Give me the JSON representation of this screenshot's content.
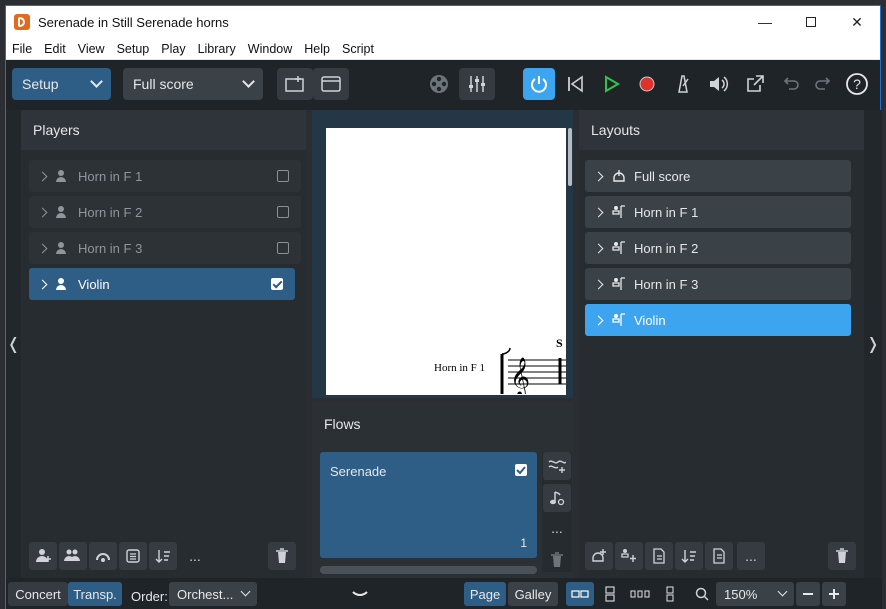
{
  "window": {
    "title": "Serenade in Still Serenade horns"
  },
  "menu": [
    "File",
    "Edit",
    "View",
    "Setup",
    "Play",
    "Library",
    "Window",
    "Help",
    "Script"
  ],
  "toolbar": {
    "mode": "Setup",
    "layout_select": "Full score"
  },
  "players_panel": {
    "heading": "Players",
    "items": [
      {
        "label": "Horn in F 1",
        "checked": false
      },
      {
        "label": "Horn in F 2",
        "checked": false
      },
      {
        "label": "Horn in F 3",
        "checked": false
      },
      {
        "label": "Violin",
        "checked": true
      }
    ],
    "more_label": "..."
  },
  "score": {
    "staff_label": "Horn in F 1",
    "cut_text": "S"
  },
  "flows_panel": {
    "heading": "Flows",
    "flow": {
      "name": "Serenade",
      "number": "1",
      "checked": true
    },
    "more_label": "..."
  },
  "layouts_panel": {
    "heading": "Layouts",
    "items": [
      {
        "label": "Full score",
        "icon": "full-score-icon"
      },
      {
        "label": "Horn in F 1",
        "icon": "part-icon"
      },
      {
        "label": "Horn in F 2",
        "icon": "part-icon"
      },
      {
        "label": "Horn in F 3",
        "icon": "part-icon"
      },
      {
        "label": "Violin",
        "icon": "part-icon"
      }
    ],
    "more_label": "..."
  },
  "statusbar": {
    "concert": "Concert",
    "transposed": "Transp.",
    "order_label": "Order:",
    "order_value": "Orchest...",
    "page": "Page",
    "galley": "Galley",
    "zoom": "150%"
  },
  "colors": {
    "accent": "#3da4f0",
    "selected": "#2e5e86",
    "record": "#e0312c",
    "play": "#36c24a"
  }
}
